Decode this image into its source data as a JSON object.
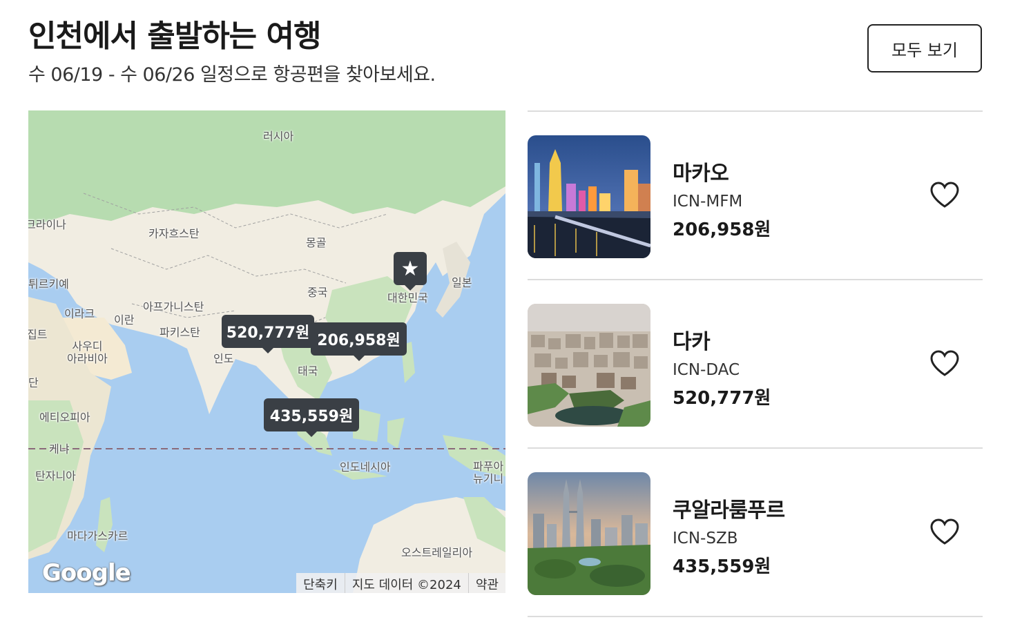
{
  "header": {
    "title": "인천에서 출발하는 여행",
    "subtitle": "수 06/19 - 수 06/26 일정으로 항공편을 찾아보세요.",
    "view_all_label": "모두 보기"
  },
  "map": {
    "labels": {
      "russia": "러시아",
      "ukraine": "크라이나",
      "kazakhstan": "카자흐스탄",
      "mongolia": "몽골",
      "turkey": "튀르키예",
      "china": "중국",
      "south_korea": "대한민국",
      "japan": "일본",
      "iraq": "이라크",
      "iran": "이란",
      "afghanistan": "아프가니스탄",
      "pakistan": "파키스탄",
      "egypt": "집트",
      "saudi": "사우디\n아라비아",
      "india": "인도",
      "thailand": "태국",
      "sudan": "단",
      "ethiopia": "에티오피아",
      "kenya": "케냐",
      "tanzania": "탄자니아",
      "indonesia": "인도네시아",
      "png": "파푸아\n뉴기니",
      "madagascar": "마다가스카르",
      "australia": "오스트레일리아"
    },
    "pins": [
      {
        "name": "dhaka",
        "price": "520,777원"
      },
      {
        "name": "macau",
        "price": "206,958원"
      },
      {
        "name": "kuala-lumpur",
        "price": "435,559원"
      }
    ],
    "origin_icon": "star-icon",
    "logo_text": "Google",
    "attribution": {
      "shortcuts": "단축키",
      "map_data": "지도 데이터 ©2024",
      "terms": "약관"
    }
  },
  "destinations": [
    {
      "name": "마카오",
      "route": "ICN-MFM",
      "price": "206,958원",
      "image": "macau-night-skyline",
      "saved": false
    },
    {
      "name": "다카",
      "route": "ICN-DAC",
      "price": "520,777원",
      "image": "dhaka-aerial-city",
      "saved": false
    },
    {
      "name": "쿠알라룸푸르",
      "route": "ICN-SZB",
      "price": "435,559원",
      "image": "kuala-lumpur-petronas-towers",
      "saved": false
    }
  ],
  "colors": {
    "map_water": "#a9cdf0",
    "map_land": "#f1ede2",
    "map_forest": "#b7dcb0",
    "pin_background": "#3a3f45",
    "divider": "#dcdcdc"
  }
}
